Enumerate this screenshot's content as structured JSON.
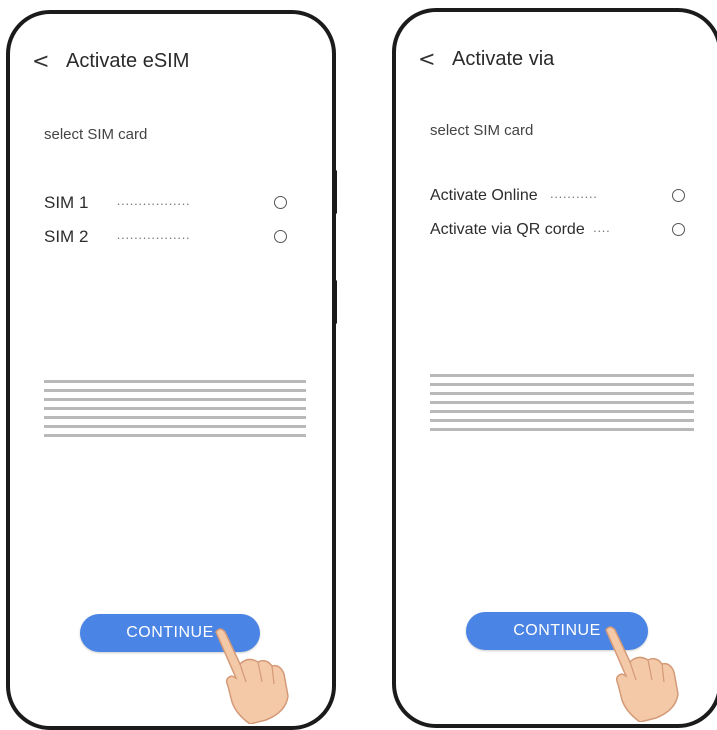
{
  "screens": [
    {
      "title": "Activate eSIM",
      "subtitle": "select SIM card",
      "options": [
        {
          "label": "SIM 1",
          "dots": "·················"
        },
        {
          "label": "SIM 2",
          "dots": "·················"
        }
      ],
      "button_label": "CONTINUE"
    },
    {
      "title": "Activate via",
      "subtitle": "select SIM card",
      "options": [
        {
          "label": "Activate Online",
          "dots": "···········"
        },
        {
          "label": "Activate via QR corde",
          "dots": "····"
        }
      ],
      "button_label": "CONTINUE"
    }
  ],
  "colors": {
    "accent": "#4a84e4",
    "frame": "#1b1b1b",
    "divider_lines": "#b9b9b9"
  },
  "icons": {
    "back": "chevron-left-icon",
    "radio": "radio-unchecked-icon",
    "pointer": "hand-pointer-icon"
  }
}
